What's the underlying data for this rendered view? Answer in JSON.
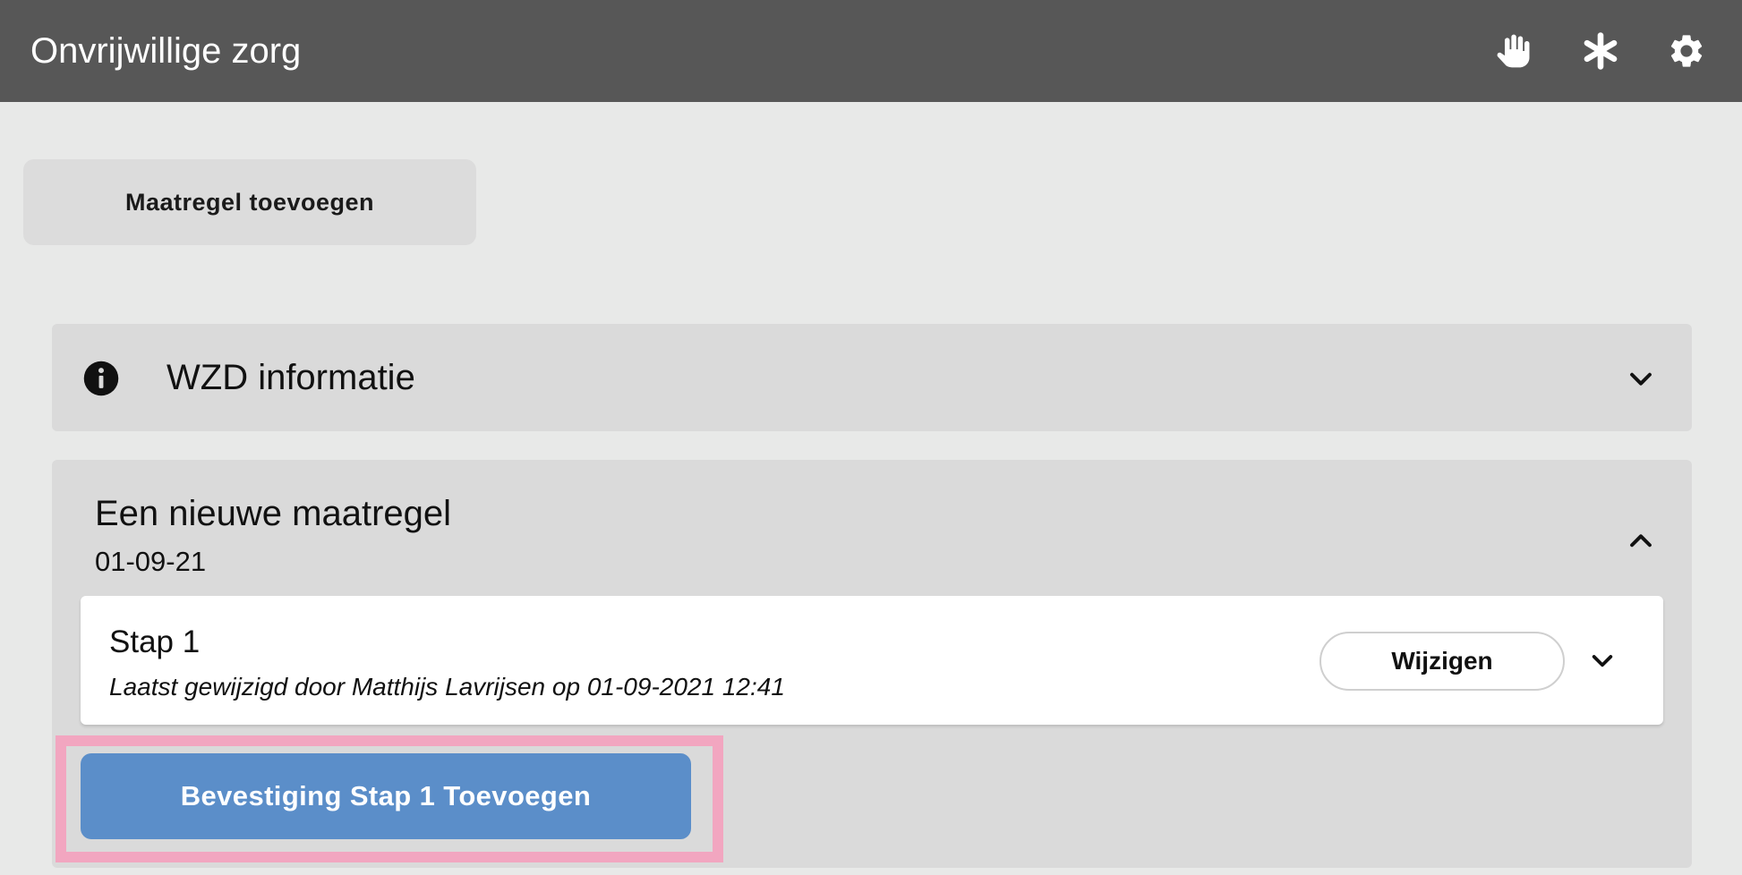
{
  "header": {
    "title": "Onvrijwillige zorg",
    "icons": [
      "hand-icon",
      "asterisk-icon",
      "gear-icon"
    ]
  },
  "toolbar": {
    "add_label": "Maatregel toevoegen"
  },
  "info_panel": {
    "title": "WZD informatie",
    "icon": "info-icon",
    "expanded": false
  },
  "measure_panel": {
    "title": "Een nieuwe maatregel",
    "date": "01-09-21",
    "expanded": true,
    "step": {
      "title": "Stap 1",
      "subtitle": "Laatst gewijzigd door Matthijs Lavrijsen op 01-09-2021 12:41",
      "edit_label": "Wijzigen"
    },
    "confirm_label": "Bevestiging Stap 1 Toevoegen"
  },
  "colors": {
    "header_bg": "#575757",
    "page_bg": "#e8e9e8",
    "panel_bg": "#dadada",
    "primary": "#5b8ec9",
    "highlight": "#f2a6c0"
  }
}
